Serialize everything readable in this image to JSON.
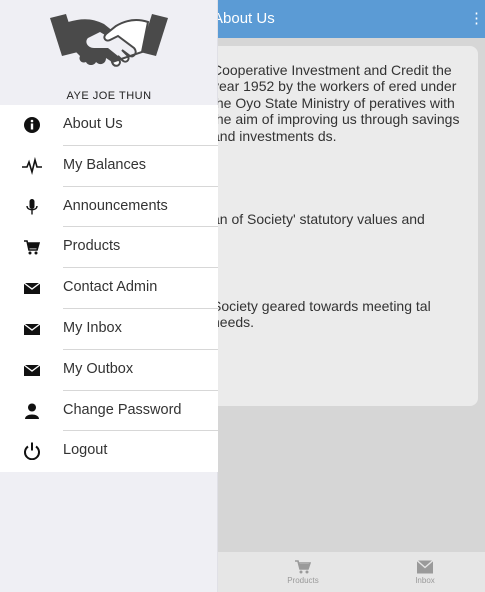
{
  "header": {
    "title": "About Us"
  },
  "content": {
    "paragraph_1": "Cooperative Investment and Credit the year 1952 by the workers of ered under the Oyo State Ministry of peratives with the aim of improving us through savings and investments ds.",
    "paragraph_2": "an of Society' statutory values and",
    "paragraph_3": "Society geared towards meeting tal needs."
  },
  "drawer": {
    "user_name": "AYE JOE THUN",
    "items": [
      {
        "label": "About Us",
        "icon": "info-icon"
      },
      {
        "label": "My Balances",
        "icon": "pulse-icon"
      },
      {
        "label": "Announcements",
        "icon": "microphone-icon"
      },
      {
        "label": "Products",
        "icon": "cart-icon"
      },
      {
        "label": "Contact Admin",
        "icon": "envelope-icon"
      },
      {
        "label": "My Inbox",
        "icon": "envelope-icon"
      },
      {
        "label": "My Outbox",
        "icon": "envelope-icon"
      },
      {
        "label": "Change Password",
        "icon": "user-icon"
      },
      {
        "label": "Logout",
        "icon": "power-icon"
      }
    ]
  },
  "bottom_nav": {
    "tabs": [
      {
        "label": "Products",
        "icon": "cart-icon"
      },
      {
        "label": "Inbox",
        "icon": "envelope-icon"
      }
    ]
  },
  "colors": {
    "app_bar": "#5b9bd5",
    "drawer_bg": "#efeff4",
    "icon": "#111111"
  }
}
